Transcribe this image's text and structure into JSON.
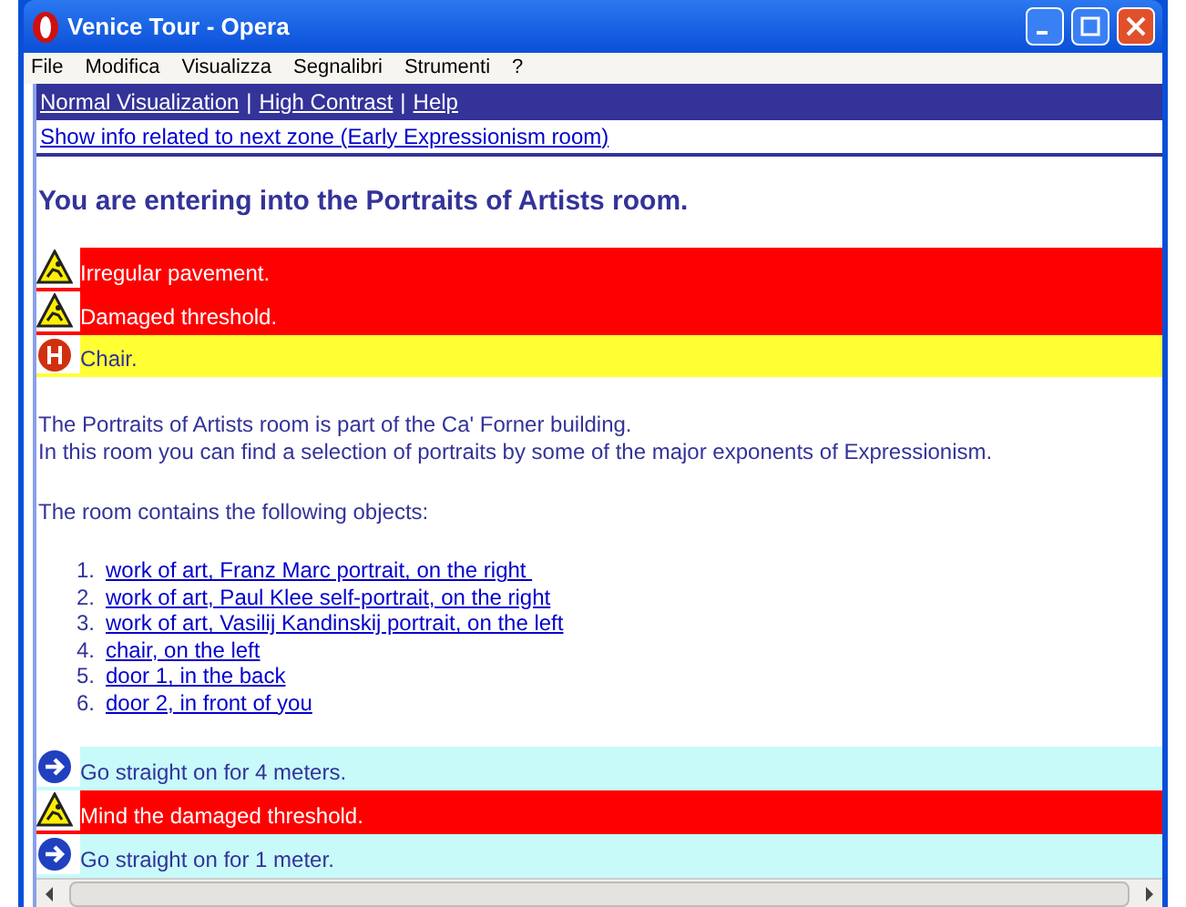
{
  "window": {
    "title": "Venice Tour - Opera"
  },
  "menu": [
    "File",
    "Modifica",
    "Visualizza",
    "Segnalibri",
    "Strumenti",
    "?"
  ],
  "nav_links": [
    "Normal Visualization",
    "High Contrast",
    "Help"
  ],
  "nav_separator": "|",
  "next_zone_link": "Show info related to next zone (Early Expressionism room)",
  "heading": "You are entering into the Portraits of Artists room.",
  "alerts": [
    {
      "kind": "hazard",
      "color": "#ff0000",
      "text": "Irregular pavement."
    },
    {
      "kind": "hazard",
      "color": "#ff0000",
      "text": "Damaged threshold."
    },
    {
      "kind": "obstacle",
      "color": "#ffff33",
      "text": "Chair."
    }
  ],
  "description": [
    "The Portraits of Artists room is part of the Ca' Forner building.",
    "In this room you can find a selection of portraits by some of the major exponents of Expressionism."
  ],
  "objects_intro": "The room contains the following objects:",
  "objects": [
    {
      "number": "1.",
      "text": "work of art, Franz Marc portrait, on the right "
    },
    {
      "number": "2.",
      "text": "work of art, Paul Klee self-portrait, on the right"
    },
    {
      "number": "3.",
      "text": "work of art, Vasilij Kandinskij portrait, on the left"
    },
    {
      "number": "4.",
      "text": "chair, on the left"
    },
    {
      "number": "5.",
      "text": "door 1, in the back"
    },
    {
      "number": "6.",
      "text": "door 2, in front of you"
    }
  ],
  "directions": [
    {
      "kind": "direction",
      "color": "#c8fafa",
      "text": "Go straight on for 4 meters."
    },
    {
      "kind": "hazard",
      "color": "#ff0000",
      "text": "Mind the damaged threshold."
    },
    {
      "kind": "direction",
      "color": "#c8fafa",
      "text": "Go straight on for 1 meter."
    }
  ]
}
